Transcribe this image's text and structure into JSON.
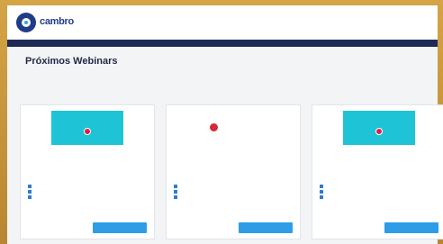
{
  "header": {
    "logo_name": "cambro",
    "logo_sub": "",
    "nav": [
      "",
      "",
      "",
      "",
      "",
      ""
    ]
  },
  "hero": {
    "title": "Próximos Webinars",
    "subtitle": ""
  },
  "cards": [
    {
      "thumb_top": "",
      "thumb_foot": "",
      "title": "",
      "meta": [
        "",
        "",
        ""
      ],
      "button": ""
    },
    {
      "brand": "",
      "title": "",
      "meta": [
        "",
        "",
        ""
      ],
      "button": ""
    },
    {
      "thumb_top": "",
      "thumb_foot": "",
      "title": "",
      "meta": [
        "",
        "",
        ""
      ],
      "button": ""
    }
  ],
  "colors": {
    "background": "#c9973a",
    "header_band": "#1c2a55",
    "button": "#2e9ce6",
    "thumb_teal": "#1fc3d6",
    "brand_red": "#d32a36"
  }
}
